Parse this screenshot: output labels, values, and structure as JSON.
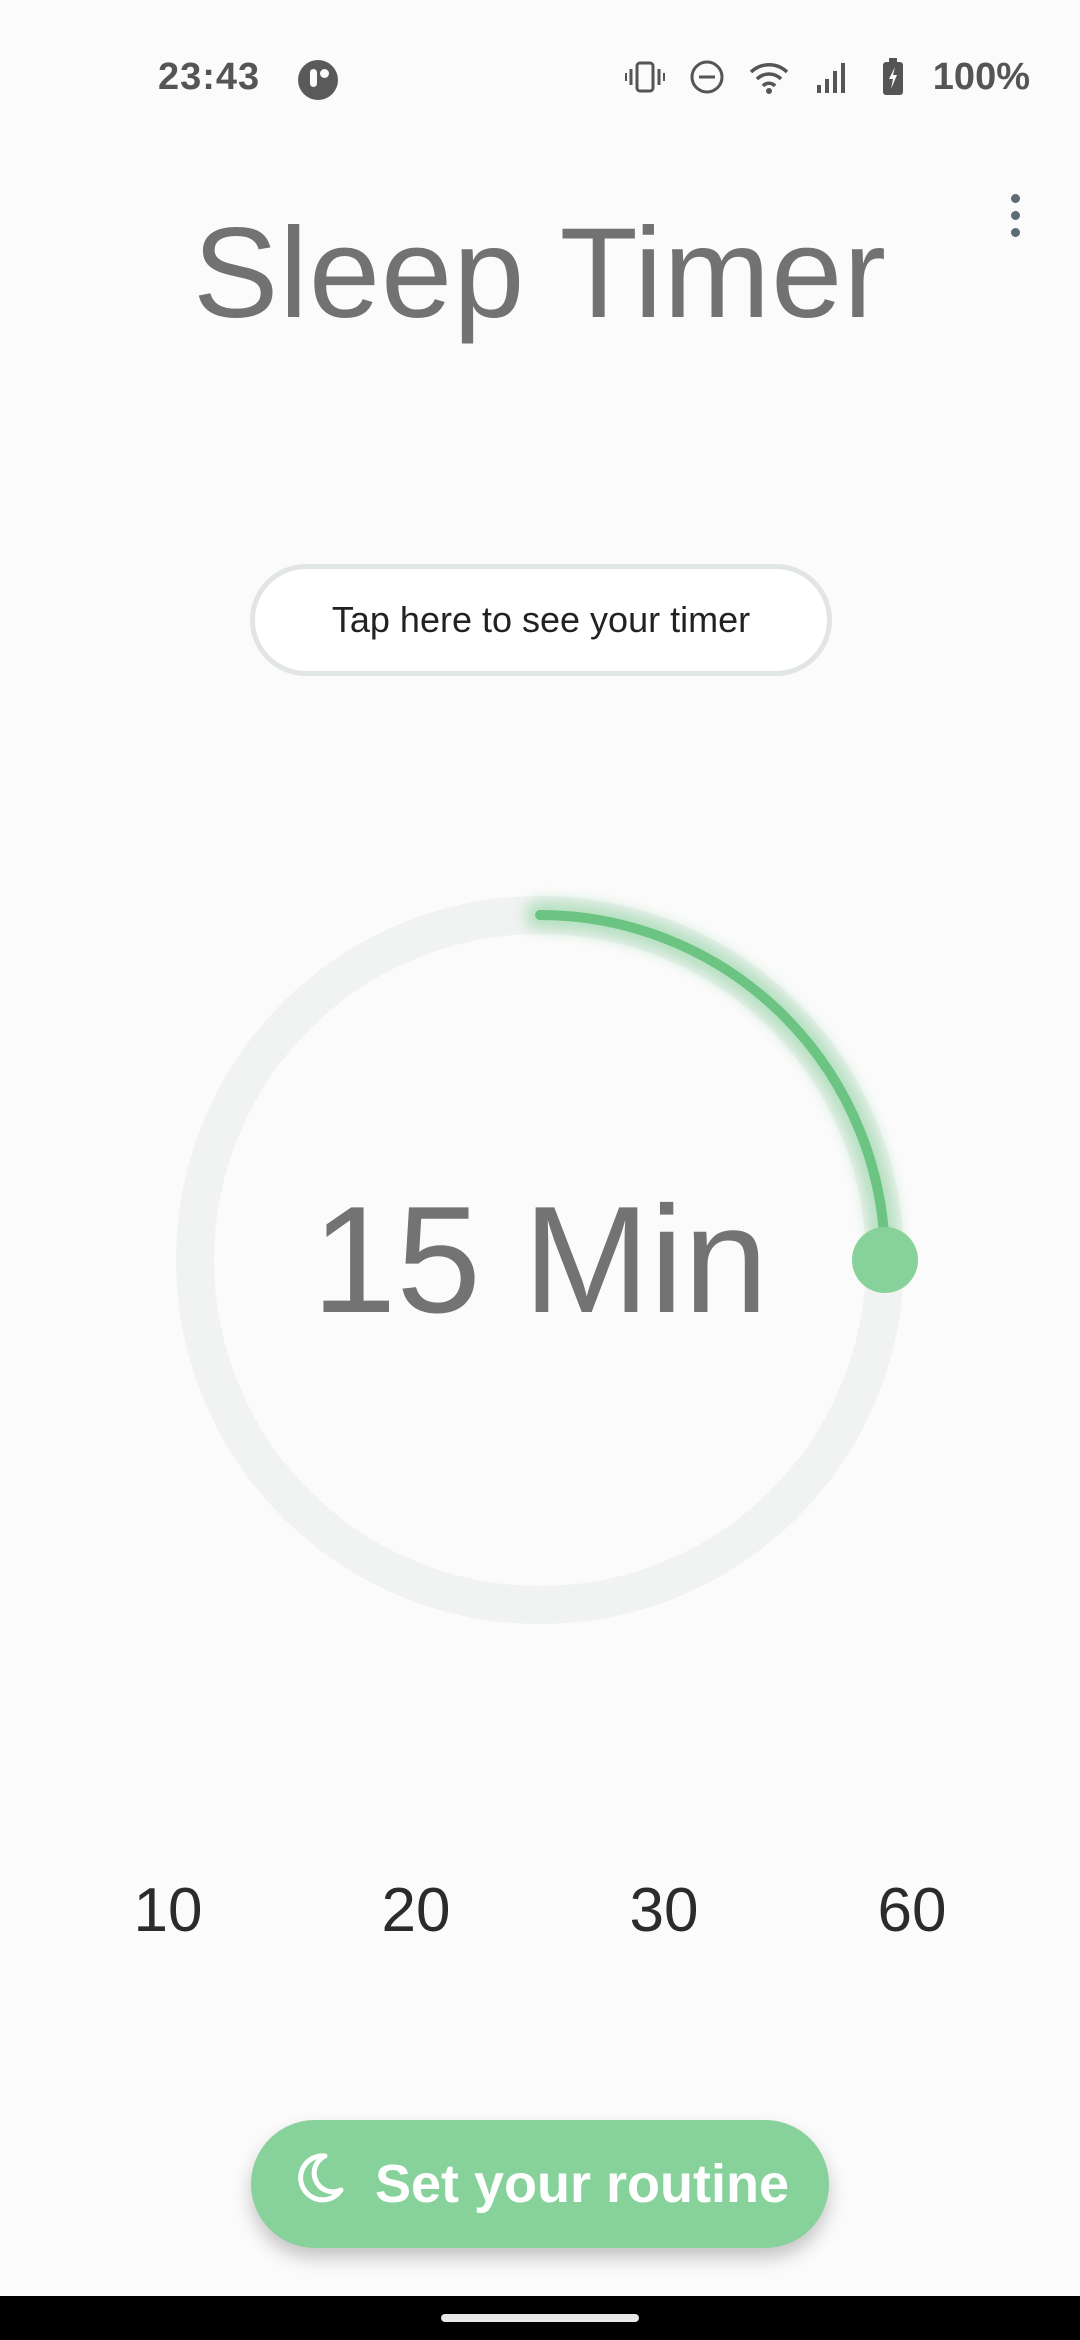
{
  "status_bar": {
    "time": "23:43",
    "app_icon": "app-notification-icon",
    "icons": [
      "vibrate-icon",
      "do-not-disturb-icon",
      "wifi-icon",
      "signal-icon",
      "battery-charging-icon"
    ],
    "battery": "100%"
  },
  "header": {
    "title": "Sleep Timer",
    "menu_icon": "more-vert-icon"
  },
  "timer_link": {
    "label": "Tap here to see your timer"
  },
  "dial": {
    "value_label": "15 Min",
    "value_minutes": 15,
    "fraction_of_ring": 0.25,
    "accent_color": "#86d29a",
    "track_color": "#f1f2f2"
  },
  "presets": [
    "10",
    "20",
    "30",
    "60"
  ],
  "routine_button": {
    "label": "Set your routine",
    "icon": "moon-icon",
    "color": "#86d29a"
  }
}
